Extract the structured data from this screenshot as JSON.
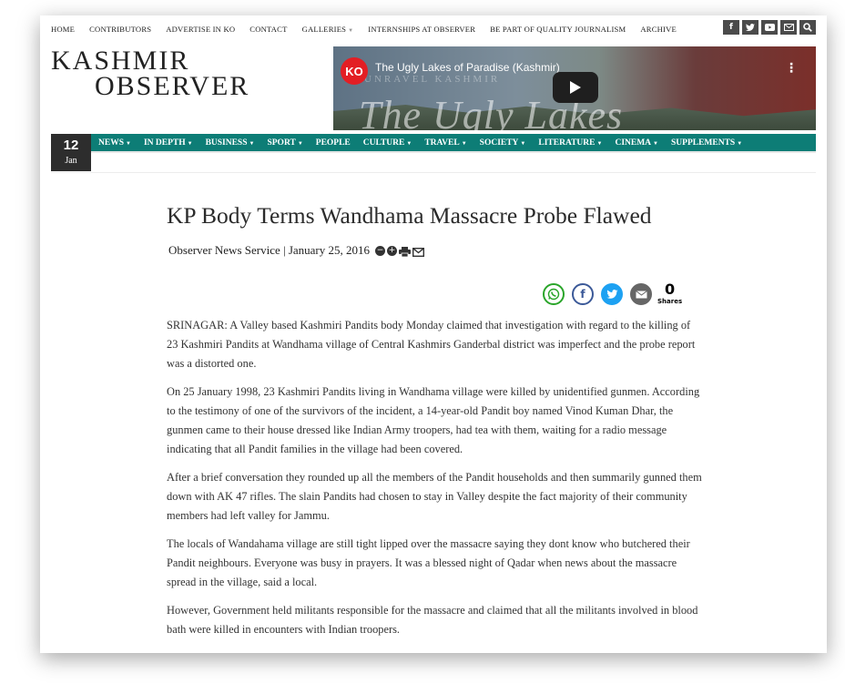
{
  "topnav": {
    "items": [
      "HOME",
      "CONTRIBUTORS",
      "ADVERTISE IN KO",
      "CONTACT",
      "GALLERIES",
      "INTERNSHIPS AT OBSERVER",
      "BE PART OF QUALITY JOURNALISM",
      "ARCHIVE"
    ],
    "social_icons": [
      "facebook-icon",
      "twitter-icon",
      "youtube-icon",
      "mail-icon",
      "search-icon"
    ]
  },
  "logo": {
    "line1": "KASHMIR",
    "line2": "OBSERVER"
  },
  "video": {
    "badge": "KO",
    "title": "The Ugly Lakes of Paradise (Kashmir)",
    "watermark_small": "UNRAVEL KASHMIR",
    "watermark_big": "The Ugly Lakes"
  },
  "date": {
    "day": "12",
    "month": "Jan"
  },
  "mainnav": {
    "items": [
      "NEWS",
      "IN DEPTH",
      "BUSINESS",
      "SPORT",
      "PEOPLE",
      "CULTURE",
      "TRAVEL",
      "SOCIETY",
      "LITERATURE",
      "CINEMA",
      "SUPPLEMENTS"
    ],
    "accent_color": "#0d7d76"
  },
  "article": {
    "title": "KP Body Terms Wandhama Massacre Probe Flawed",
    "byline": "Observer News Service | January 25, 2016",
    "shares_count": "0",
    "shares_label": "Shares",
    "paragraphs": [
      "SRINAGAR: A Valley based Kashmiri Pandits body Monday claimed that investigation with regard to the killing of 23 Kashmiri Pandits at Wandhama village of Central Kashmirs Ganderbal district was imperfect and the probe report was a distorted one.",
      "On 25 January 1998, 23 Kashmiri Pandits living in Wandhama village were killed by unidentified gunmen. According to the testimony of one of the survivors of the incident, a 14-year-old Pandit boy named Vinod Kuman Dhar, the gunmen came to their house dressed like Indian Army troopers, had tea with them, waiting for a radio message indicating that all Pandit families in the village had been covered.",
      "After a brief conversation they rounded up all the members of the Pandit households and then summarily gunned them down with AK 47 rifles. The slain Pandits had chosen to stay in Valley despite the fact majority of their community members had left valley for Jammu.",
      "The locals of Wandahama village are still tight lipped over the massacre saying they dont know who butchered their Pandit neighbours. Everyone was busy in prayers. It was a blessed night of Qadar when news about the massacre spread in the village, said a local.",
      "However, Government held militants responsible for the massacre and claimed that all the militants involved in blood bath were killed in encounters with Indian troopers."
    ]
  }
}
